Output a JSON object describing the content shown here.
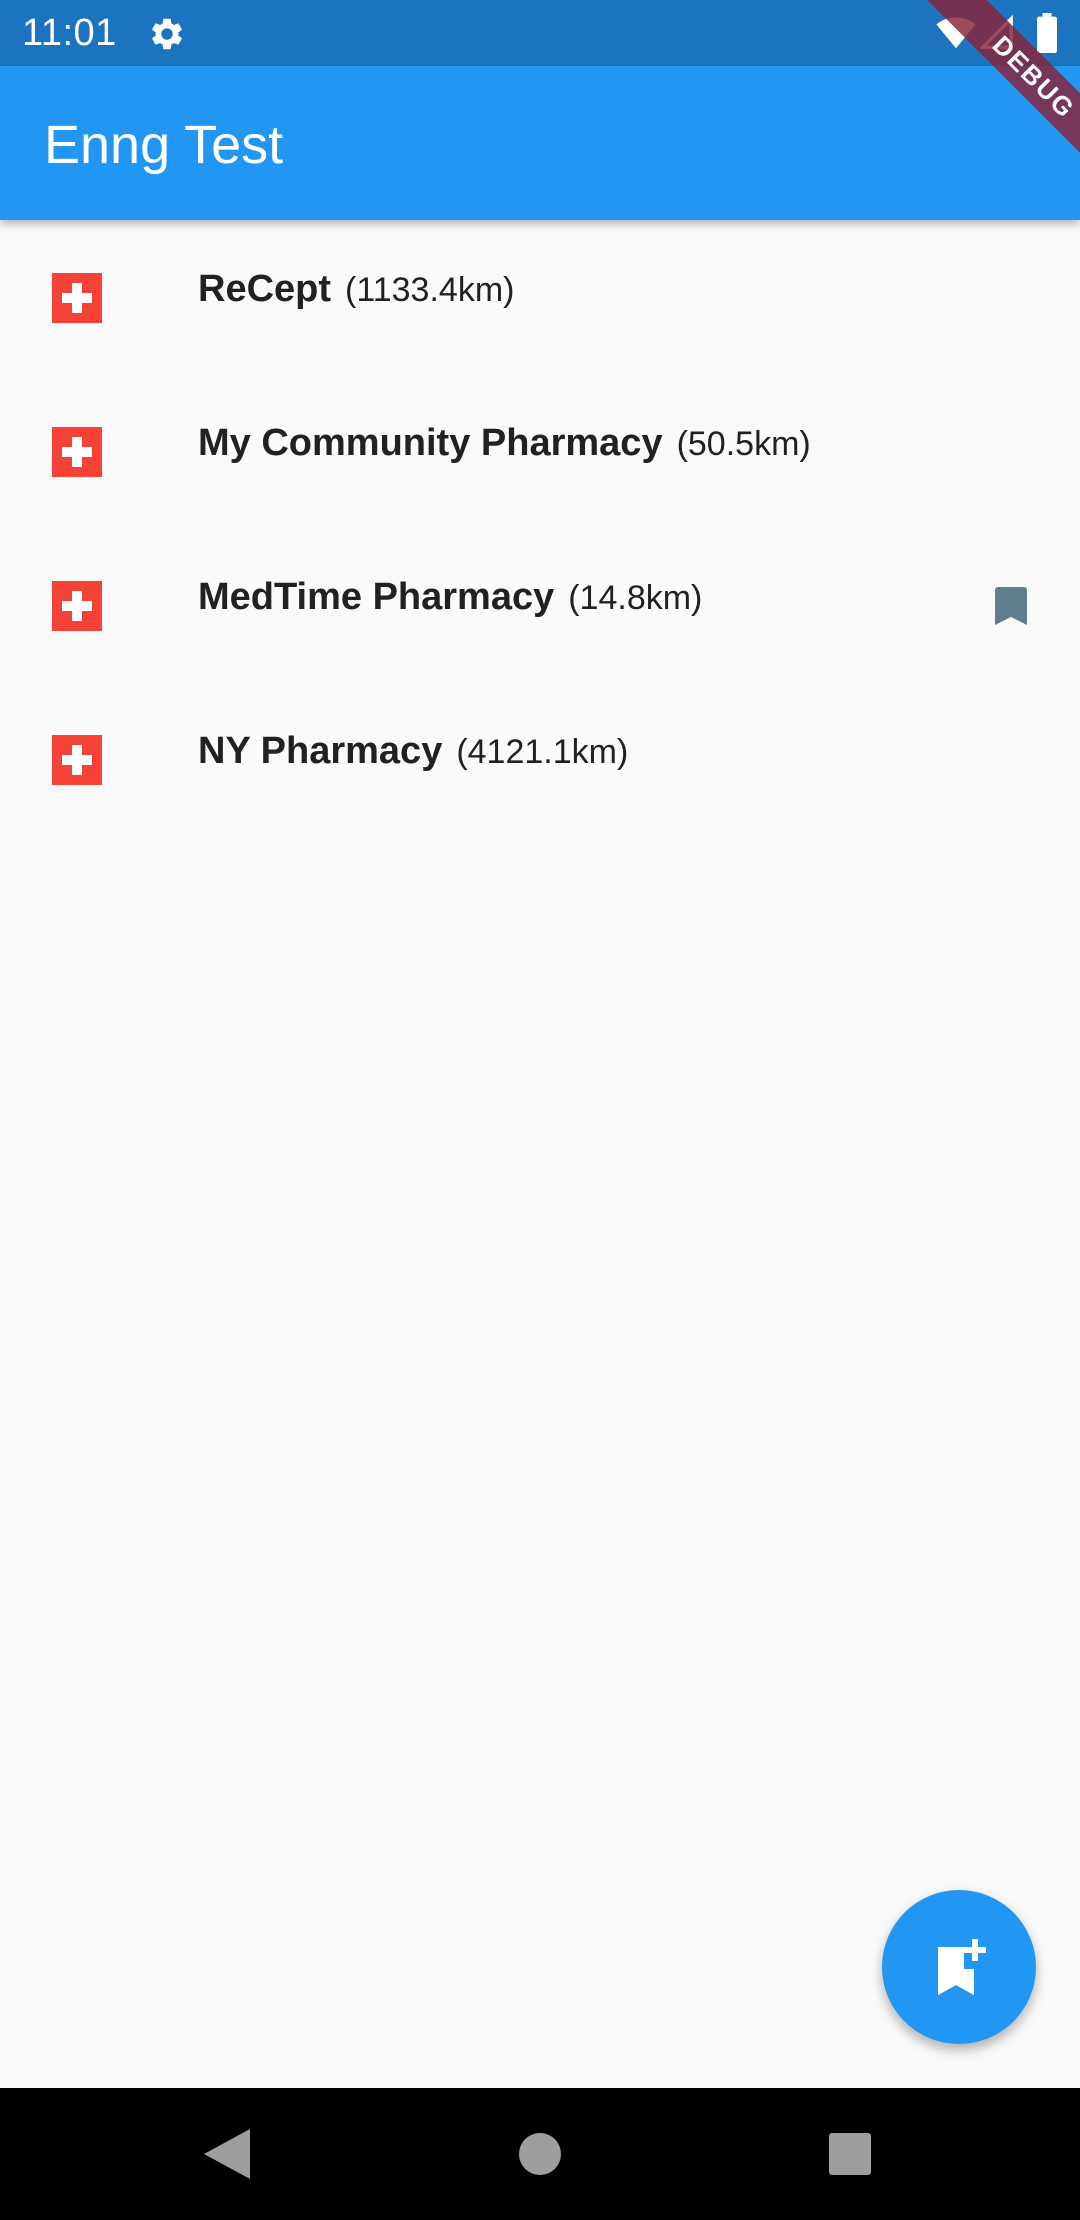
{
  "status_bar": {
    "time": "11:01",
    "icons": [
      "gear-icon",
      "wifi-icon",
      "signal-icon",
      "battery-icon"
    ]
  },
  "app_bar": {
    "title": "Enng Test"
  },
  "debug_banner": {
    "label": "DEBUG"
  },
  "pharmacies": [
    {
      "name": "ReCept",
      "distance": "(1133.4km)",
      "bookmarked": false
    },
    {
      "name": "My Community Pharmacy",
      "distance": "(50.5km)",
      "bookmarked": false
    },
    {
      "name": "MedTime Pharmacy",
      "distance": "(14.8km)",
      "bookmarked": true
    },
    {
      "name": "NY Pharmacy",
      "distance": "(4121.1km)",
      "bookmarked": false
    }
  ],
  "fab": {
    "icon": "bookmark-add-icon"
  },
  "colors": {
    "status_bar": "#1c73c0",
    "app_bar": "#2196f3",
    "pharmacy_icon": "#f44336",
    "bookmark": "#607d8b",
    "background": "#fafafa"
  }
}
